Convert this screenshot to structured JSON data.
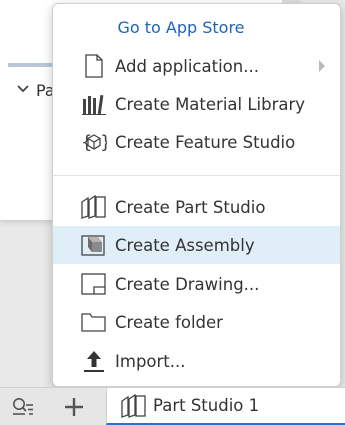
{
  "background": {
    "partial_label": "Pa"
  },
  "menu": {
    "header": "Go to App Store",
    "items": [
      {
        "label": "Add application...",
        "icon": "document-icon",
        "has_submenu": true
      },
      {
        "label": "Create Material Library",
        "icon": "material-library-icon"
      },
      {
        "label": "Create Feature Studio",
        "icon": "feature-studio-icon"
      },
      {
        "label": "Create Part Studio",
        "icon": "part-studio-icon"
      },
      {
        "label": "Create Assembly",
        "icon": "assembly-icon",
        "highlighted": true
      },
      {
        "label": "Create Drawing...",
        "icon": "drawing-icon"
      },
      {
        "label": "Create folder",
        "icon": "folder-icon"
      },
      {
        "label": "Import...",
        "icon": "upload-icon"
      }
    ]
  },
  "tabbar": {
    "active_tab": "Part Studio 1"
  },
  "colors": {
    "link": "#1f63b8",
    "highlight": "#e0eef8",
    "tab_underline": "#2f6fd0"
  }
}
